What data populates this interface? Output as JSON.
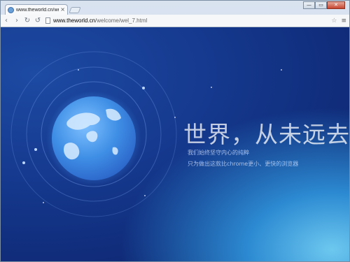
{
  "browser": {
    "tab": {
      "title": "www.theworld.cn/welco",
      "close": "×"
    },
    "window_controls": {
      "minimize": "—",
      "maximize": "▭",
      "close": "✕"
    },
    "nav": {
      "back": "‹",
      "forward": "›",
      "reload": "↻",
      "stop": "↺"
    },
    "url": {
      "host": "www.theworld.cn",
      "path": "/welcome/wel_7.html"
    },
    "star": "☆",
    "menu": "≡"
  },
  "page": {
    "headline": "世界，从未远去",
    "subtitle_1": "我们始终坚守内心的纯粹",
    "subtitle_2": "只为做出这款比chrome更小、更快的浏览器"
  },
  "colors": {
    "background": "#15398e",
    "accent_glow": "#6dc8ef",
    "globe": "#3f8fe6"
  }
}
